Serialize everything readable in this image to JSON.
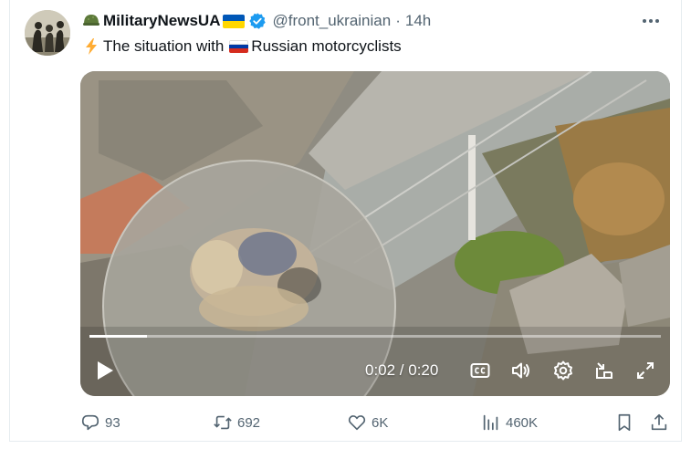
{
  "tweet": {
    "author_name": "MilitaryNewsUA",
    "handle": "@front_ukrainian",
    "separator": "·",
    "time_ago": "14h",
    "text": "The situation with",
    "text_rest": "Russian motorcyclists"
  },
  "video": {
    "current_time": "0:02 / 0:20",
    "progress": 0.1
  },
  "actions": {
    "replies": "93",
    "retweets": "692",
    "likes": "6K",
    "views": "460K"
  },
  "colors": {
    "verified": "#1d9bf0",
    "muted": "#536471",
    "flag_ua_blue": "#0057b7",
    "flag_ua_yellow": "#ffd700"
  },
  "icons": [
    "helmet-emoji",
    "flag-ukraine",
    "verified-badge",
    "more-icon",
    "lightning-emoji",
    "flag-russia",
    "play-icon",
    "captions-icon",
    "volume-icon",
    "settings-icon",
    "picture-in-picture-icon",
    "fullscreen-icon",
    "reply-icon",
    "retweet-icon",
    "like-icon",
    "views-icon",
    "bookmark-icon",
    "share-icon"
  ]
}
